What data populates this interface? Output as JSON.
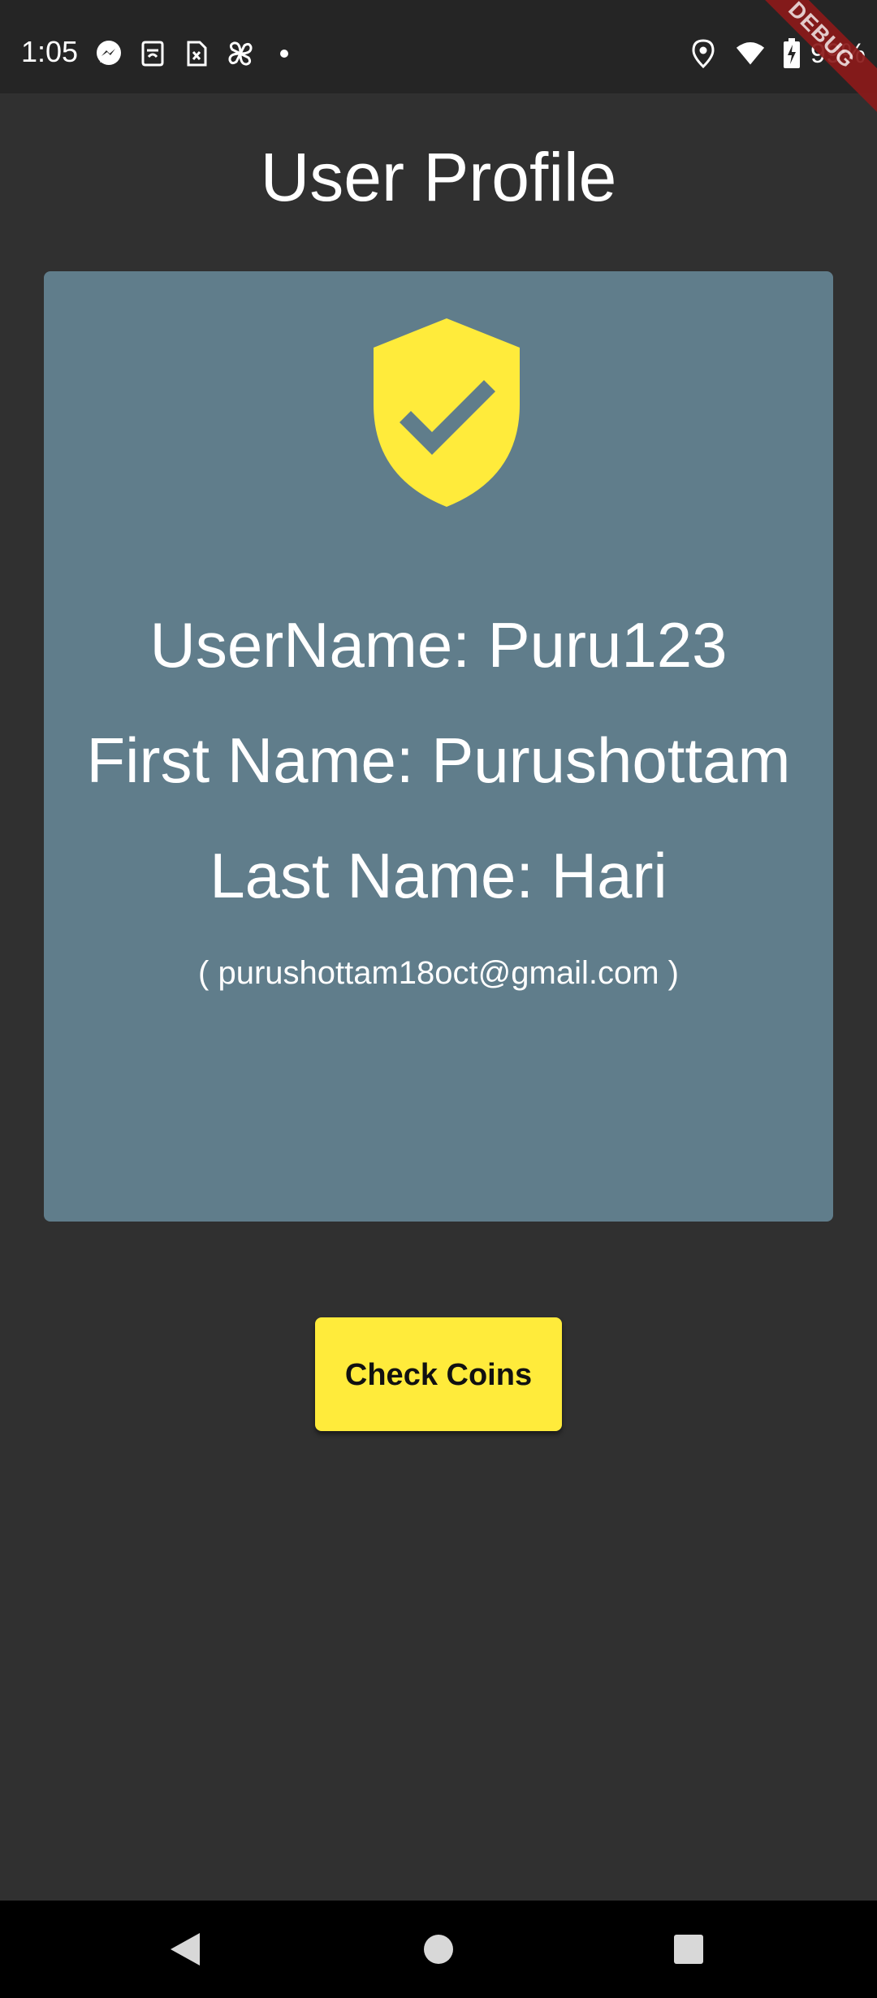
{
  "status_bar": {
    "time": "1:05",
    "battery": "99%",
    "left_icons": [
      "messenger-icon",
      "notification-app-icon",
      "sim-card-icon",
      "pinwheel-icon",
      "dot-icon"
    ],
    "right_icons": [
      "location-icon",
      "wifi-icon",
      "battery-charging-icon"
    ]
  },
  "debug_banner": "DEBUG",
  "title": "User Profile",
  "profile": {
    "icon": "verified-shield-check-icon",
    "username_line": "UserName: Puru123",
    "first_name_line": "First Name: Purushottam",
    "last_name_line": "Last Name: Hari",
    "email_line": "( purushottam18oct@gmail.com )"
  },
  "actions": {
    "check_coins_label": "Check Coins"
  },
  "nav": [
    "back-icon",
    "home-icon",
    "recents-icon"
  ],
  "colors": {
    "background": "#303030",
    "status_bar": "#252525",
    "card": "#607d8b",
    "accent_yellow": "#ffeb3b",
    "nav_bar": "#000000",
    "debug_ribbon": "#8b1a1a"
  }
}
